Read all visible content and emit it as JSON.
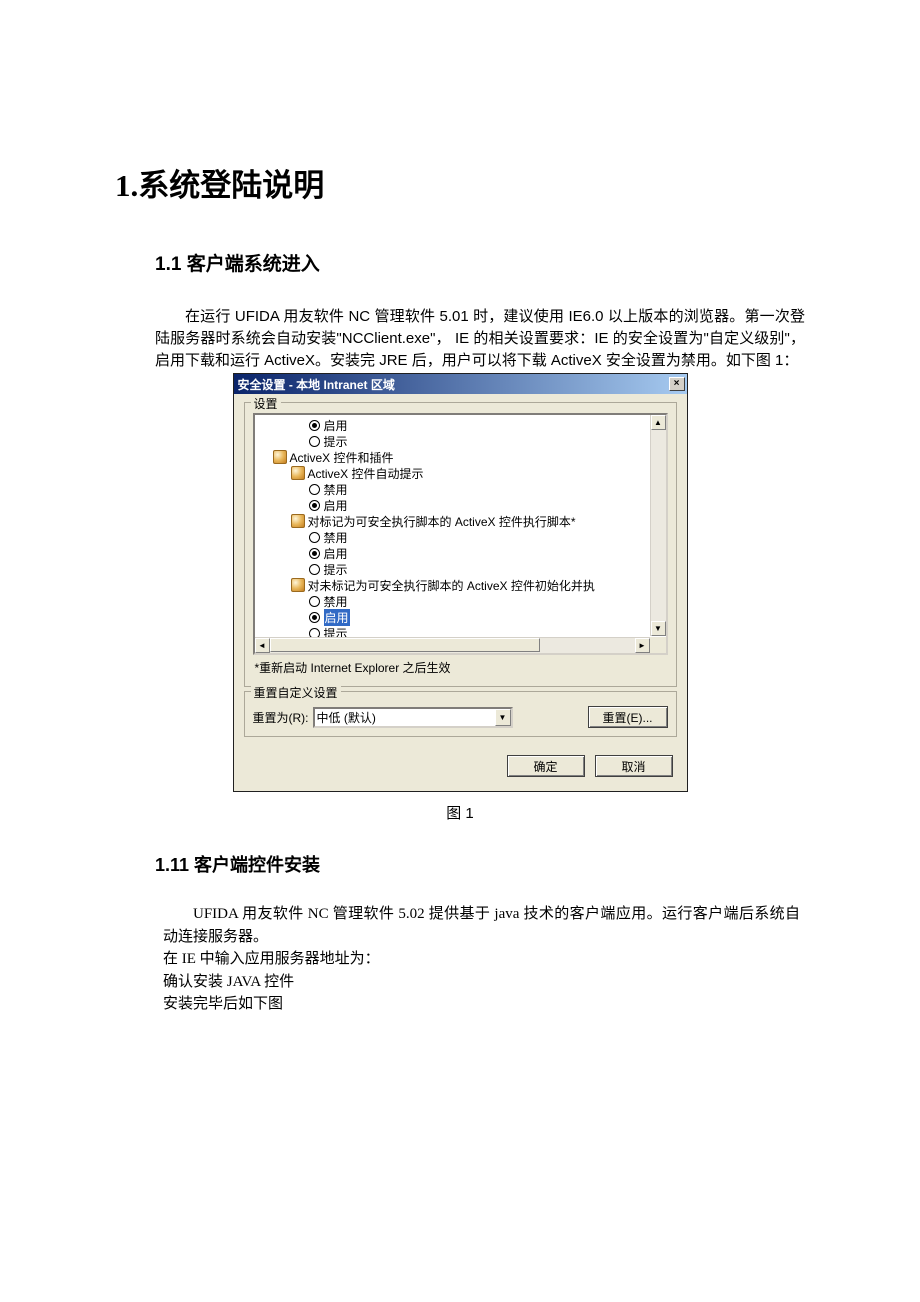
{
  "heading1": "1.系统登陆说明",
  "heading2": "1.1 客户端系统进入",
  "para1": "在运行 UFIDA 用友软件 NC 管理软件 5.01 时，建议使用 IE6.0 以上版本的浏览器。第一次登陆服务器时系统会自动安装\"NCClient.exe\"， IE 的相关设置要求：IE 的安全设置为\"自定义级别\"，启用下载和运行 ActiveX。安装完 JRE 后，用户可以将下载 ActiveX 安全设置为禁用。如下图 1：",
  "dialog": {
    "title": "安全设置 - 本地 Intranet 区域",
    "close": "×",
    "group_settings": "设置",
    "tree": {
      "r1": "启用",
      "r2": "提示",
      "n1": "ActiveX 控件和插件",
      "n2": "ActiveX 控件自动提示",
      "r3": "禁用",
      "r4": "启用",
      "n3": "对标记为可安全执行脚本的 ActiveX 控件执行脚本*",
      "r5": "禁用",
      "r6": "启用",
      "r7": "提示",
      "n4": "对未标记为可安全执行脚本的 ActiveX 控件初始化并执",
      "r8": "禁用",
      "r9": "启用",
      "r10": "提示"
    },
    "footnote": "*重新启动 Internet Explorer 之后生效",
    "group_reset": "重置自定义设置",
    "reset_label": "重置为(R):",
    "reset_value": "中低 (默认)",
    "reset_btn": "重置(E)...",
    "ok": "确定",
    "cancel": "取消"
  },
  "caption1": "图 1",
  "heading3": "1.11 客户端控件安装",
  "body2_p1": "UFIDA 用友软件 NC 管理软件 5.02 提供基于 java 技术的客户端应用。运行客户端后系统自动连接服务器。",
  "body2_p2": "在 IE 中输入应用服务器地址为：",
  "body2_p3": "确认安装 JAVA 控件",
  "body2_p4": "安装完毕后如下图"
}
